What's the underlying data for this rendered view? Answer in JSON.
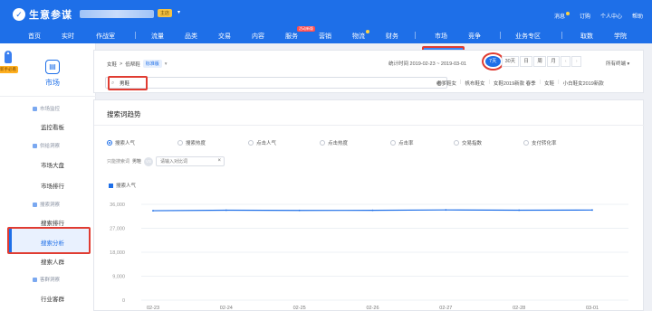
{
  "header": {
    "logo_text": "生意参谋",
    "shop_badge": "主店",
    "right_links": [
      "消息",
      "订购",
      "个人中心",
      "帮助"
    ]
  },
  "nav": {
    "items": [
      {
        "label": "首页"
      },
      {
        "label": "实时"
      },
      {
        "label": "作战室"
      },
      {
        "label": "流量"
      },
      {
        "label": "品类"
      },
      {
        "label": "交易"
      },
      {
        "label": "内容"
      },
      {
        "label": "服务",
        "badge": "活动新版"
      },
      {
        "label": "营销"
      },
      {
        "label": "物流"
      },
      {
        "label": "财务"
      },
      {
        "label": "市场"
      },
      {
        "label": "竞争"
      },
      {
        "label": "业务专区"
      },
      {
        "label": "取数"
      },
      {
        "label": "学院"
      }
    ],
    "active": "市场"
  },
  "sidebar": {
    "title": "市场",
    "floating_tag": "新手必看",
    "groups": [
      {
        "label": "市场监控",
        "items": [
          "监控看板"
        ]
      },
      {
        "label": "供给洞察",
        "items": [
          "市场大盘",
          "市场排行"
        ]
      },
      {
        "label": "搜索洞察",
        "items": [
          "搜索排行",
          "搜索分析",
          "搜索人群"
        ]
      },
      {
        "label": "客群洞察",
        "items": [
          "行业客群"
        ]
      }
    ],
    "active_item": "搜索分析"
  },
  "filter": {
    "breadcrumb_root": "女鞋",
    "breadcrumb_leaf": "低帮鞋",
    "breadcrumb_selector": "标准版",
    "stat_time": "统计时间 2019-02-23 ~ 2019-03-01",
    "periods": [
      "7天",
      "30天",
      "日",
      "周",
      "月"
    ],
    "active_period": "7天",
    "terminal": "所有终端",
    "search_value": "男鞋",
    "suggestions": [
      "老爹鞋女",
      "帆布鞋女",
      "女鞋2019新款 春季",
      "女鞋",
      "小白鞋女2019新款"
    ]
  },
  "trend": {
    "title": "搜索词趋势",
    "metrics": [
      "搜索人气",
      "搜索热度",
      "点击人气",
      "点击热度",
      "点击率",
      "交易指数",
      "支付转化率"
    ],
    "active_metric": "搜索人气",
    "compare_label": "只能搜索词",
    "compare_self": "男鞋",
    "compare_vs": "VS",
    "compare_placeholder": "请输入对比词"
  },
  "chart_data": {
    "type": "line",
    "x": [
      "02-23",
      "02-24",
      "02-25",
      "02-26",
      "02-27",
      "02-28",
      "03-01"
    ],
    "series": [
      {
        "name": "搜索人气",
        "values": [
          33600,
          33800,
          33700,
          33750,
          33900,
          33800,
          33850
        ]
      }
    ],
    "y_ticks": [
      "36,000",
      "27,000",
      "18,000",
      "9,000",
      "0"
    ],
    "ylim": [
      0,
      36000
    ],
    "grid": true,
    "legend_position": "top-left",
    "colors": {
      "series": "#1e6fe8",
      "accent": "#1e6fe8",
      "highlight": "#e03c32"
    }
  }
}
